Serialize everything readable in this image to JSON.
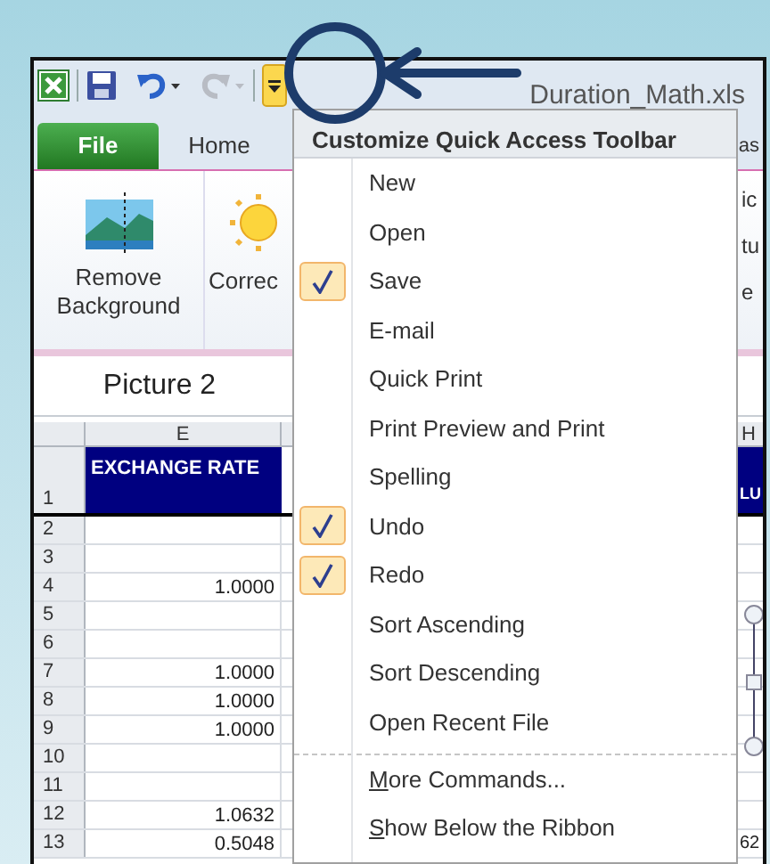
{
  "window": {
    "title": "Duration_Math.xls"
  },
  "ribbon_tabs": [
    {
      "label": "File",
      "kind": "file",
      "selected": false
    },
    {
      "label": "Home",
      "kind": "tab",
      "selected": false
    },
    {
      "label": "as",
      "kind": "clipped",
      "selected": false
    }
  ],
  "ribbon": {
    "buttons": [
      {
        "label": "Remove Background",
        "kind": "remove"
      },
      {
        "label": "Correc",
        "kind": "corrections"
      }
    ],
    "clipped_labels": [
      "ic",
      "tu",
      "e"
    ]
  },
  "name_box": {
    "value": "Picture 2"
  },
  "sheet": {
    "columns": [
      "E",
      "H"
    ],
    "header_cells": [
      "EXCHANGE RATE",
      "LU"
    ],
    "rows": [
      {
        "number": "1"
      },
      {
        "number": "2",
        "e": ""
      },
      {
        "number": "3",
        "e": ""
      },
      {
        "number": "4",
        "e": "1.0000"
      },
      {
        "number": "5",
        "e": ""
      },
      {
        "number": "6",
        "e": ""
      },
      {
        "number": "7",
        "e": "1.0000"
      },
      {
        "number": "8",
        "e": "1.0000"
      },
      {
        "number": "9",
        "e": "1.0000"
      },
      {
        "number": "10",
        "e": ""
      },
      {
        "number": "11",
        "e": ""
      },
      {
        "number": "12",
        "e": "1.0632"
      },
      {
        "number": "13",
        "e": "0.5048",
        "h": "62"
      }
    ]
  },
  "menu": {
    "title": "Customize Quick Access Toolbar",
    "items": [
      {
        "label": "New",
        "kind": "option",
        "checked": false
      },
      {
        "label": "Open",
        "kind": "option",
        "checked": false
      },
      {
        "label": "Save",
        "kind": "option",
        "checked": true
      },
      {
        "label": "E-mail",
        "kind": "option",
        "checked": false
      },
      {
        "label": "Quick Print",
        "kind": "option",
        "checked": false
      },
      {
        "label": "Print Preview and Print",
        "kind": "option",
        "checked": false
      },
      {
        "label": "Spelling",
        "kind": "option",
        "checked": false
      },
      {
        "label": "Undo",
        "kind": "option",
        "checked": true
      },
      {
        "label": "Redo",
        "kind": "option",
        "checked": true
      },
      {
        "label": "Sort Ascending",
        "kind": "option",
        "checked": false
      },
      {
        "label": "Sort Descending",
        "kind": "option",
        "checked": false
      },
      {
        "label": "Open Recent File",
        "kind": "option",
        "checked": false
      },
      {
        "label": "More Commands...",
        "kind": "command",
        "underline_first": true,
        "separator_before": true
      },
      {
        "label": "Show Below the Ribbon",
        "kind": "command",
        "underline_first": true,
        "separator_before": false
      }
    ]
  }
}
